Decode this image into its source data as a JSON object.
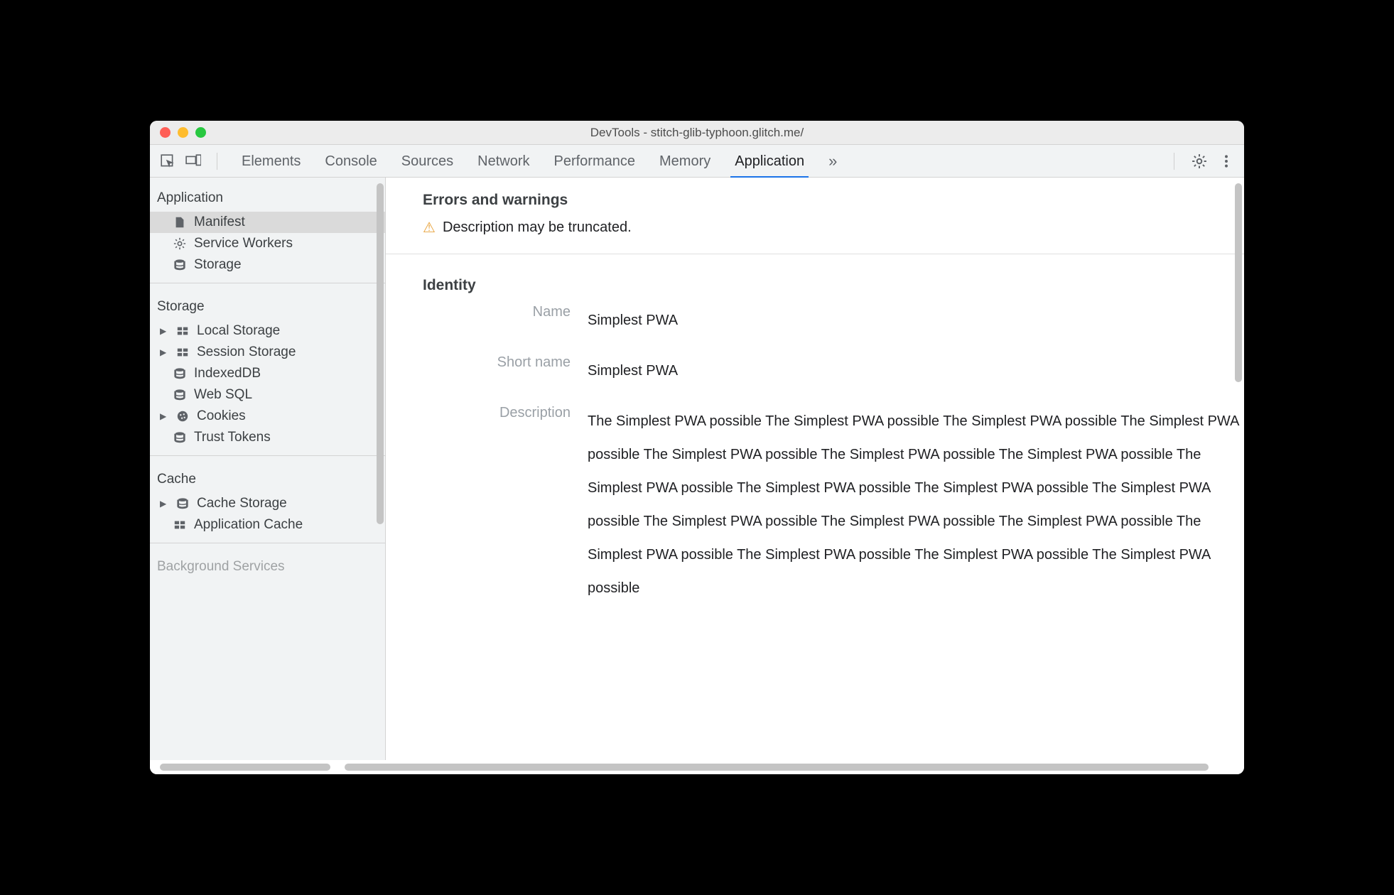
{
  "window": {
    "title": "DevTools - stitch-glib-typhoon.glitch.me/"
  },
  "toolbar": {
    "tabs": [
      "Elements",
      "Console",
      "Sources",
      "Network",
      "Performance",
      "Memory",
      "Application"
    ],
    "active_tab": "Application",
    "overflow_glyph": "»"
  },
  "sidebar": {
    "sections": [
      {
        "title": "Application",
        "items": [
          {
            "label": "Manifest",
            "icon": "file-icon",
            "selected": true
          },
          {
            "label": "Service Workers",
            "icon": "gear-icon"
          },
          {
            "label": "Storage",
            "icon": "database-icon"
          }
        ]
      },
      {
        "title": "Storage",
        "items": [
          {
            "label": "Local Storage",
            "icon": "table-icon",
            "expandable": true
          },
          {
            "label": "Session Storage",
            "icon": "table-icon",
            "expandable": true
          },
          {
            "label": "IndexedDB",
            "icon": "database-icon"
          },
          {
            "label": "Web SQL",
            "icon": "database-icon"
          },
          {
            "label": "Cookies",
            "icon": "cookie-icon",
            "expandable": true
          },
          {
            "label": "Trust Tokens",
            "icon": "database-icon"
          }
        ]
      },
      {
        "title": "Cache",
        "items": [
          {
            "label": "Cache Storage",
            "icon": "database-icon",
            "expandable": true
          },
          {
            "label": "Application Cache",
            "icon": "table-icon"
          }
        ]
      },
      {
        "title": "Background Services",
        "items": []
      }
    ]
  },
  "panel": {
    "errors_heading": "Errors and warnings",
    "warning_text": "Description may be truncated.",
    "identity_heading": "Identity",
    "fields": {
      "name_label": "Name",
      "name_value": "Simplest PWA",
      "short_name_label": "Short name",
      "short_name_value": "Simplest PWA",
      "description_label": "Description",
      "description_value": "The Simplest PWA possible The Simplest PWA possible The Simplest PWA possible The Simplest PWA possible The Simplest PWA possible The Simplest PWA possible The Simplest PWA possible The Simplest PWA possible The Simplest PWA possible The Simplest PWA possible The Simplest PWA possible The Simplest PWA possible The Simplest PWA possible The Simplest PWA possible The Simplest PWA possible The Simplest PWA possible The Simplest PWA possible The Simplest PWA possible"
    }
  }
}
